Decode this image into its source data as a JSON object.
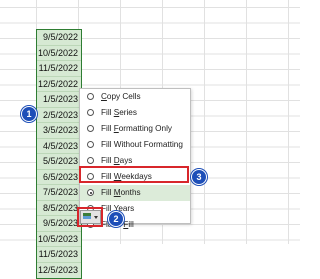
{
  "cells": [
    "9/5/2022",
    "10/5/2022",
    "11/5/2022",
    "12/5/2022",
    "1/5/2023",
    "2/5/2023",
    "3/5/2023",
    "4/5/2023",
    "5/5/2023",
    "6/5/2023",
    "7/5/2023",
    "8/5/2023",
    "9/5/2023",
    "10/5/2023",
    "11/5/2023",
    "12/5/2023"
  ],
  "menu": {
    "items": [
      {
        "label": "Copy Cells",
        "underline": "C",
        "selected": false
      },
      {
        "label": "Fill Series",
        "underline": "S",
        "selected": false
      },
      {
        "label": "Fill Formatting Only",
        "underline": "F",
        "selected": false
      },
      {
        "label": "Fill Without Formatting",
        "underline": "O",
        "selected": false
      },
      {
        "label": "Fill Days",
        "underline": "D",
        "selected": false
      },
      {
        "label": "Fill Weekdays",
        "underline": "W",
        "selected": false
      },
      {
        "label": "Fill Months",
        "underline": "M",
        "selected": true
      },
      {
        "label": "Fill Years",
        "underline": "Y",
        "selected": false
      },
      {
        "label": "Flash Fill",
        "underline": "F",
        "selected": false
      }
    ]
  },
  "badges": {
    "one": "1",
    "two": "2",
    "three": "3"
  },
  "colors": {
    "accent_green": "#2e7d32",
    "badge_blue": "#1e4fb8",
    "highlight_red": "#d8262b"
  }
}
